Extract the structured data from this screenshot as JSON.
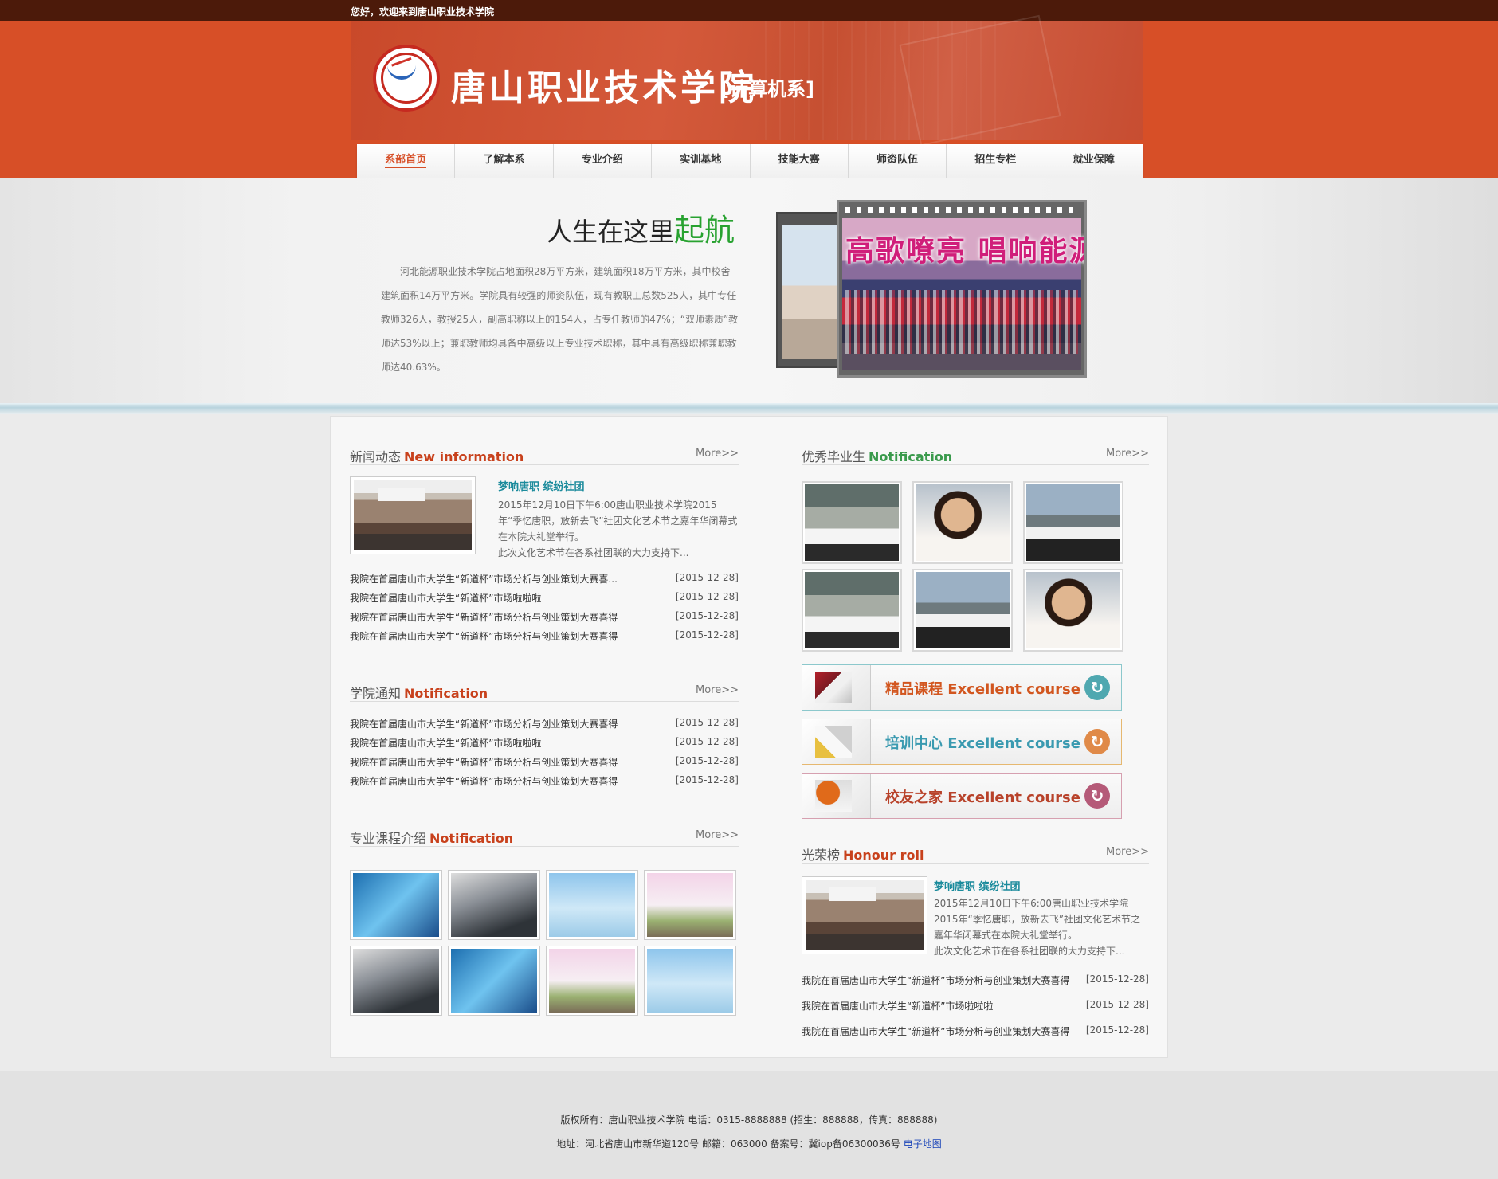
{
  "topbar": {
    "welcome": "您好，欢迎来到唐山职业技术学院"
  },
  "header": {
    "school_name": "唐山职业技术学院",
    "department": "[计算机系]"
  },
  "nav": {
    "items": [
      "系部首页",
      "了解本系",
      "专业介绍",
      "实训基地",
      "技能大赛",
      "师资队伍",
      "招生专栏",
      "就业保障"
    ],
    "active": "系部首页"
  },
  "hero": {
    "title_prefix": "人生在这里",
    "title_accent": "起航",
    "text": "河北能源职业技术学院占地面积28万平方米，建筑面积18万平方米，其中校舍建筑面积14万平方米。学院具有较强的师资队伍，现有教职工总数525人，其中专任教师326人，教授25人，副高职称以上的154人，占专任教师的47%；“双师素质”教师达53%以上；兼职教师均具备中高级以上专业技术职称，其中具有高级职称兼职教师达40.63%。",
    "photo_caption": "高歌嘹亮  唱响能源"
  },
  "news": {
    "title_cn": "新闻动态",
    "title_en": "New information",
    "more": "More>>",
    "feature_title": "梦响唐职 缤纷社团",
    "feature_text": "2015年12月10日下午6:00唐山职业技术学院2015年“季忆唐职，放新去飞”社团文化艺术节之嘉年华闭幕式在本院大礼堂举行。",
    "feature_text2": "此次文化艺术节在各系社团联的大力支持下...",
    "items": [
      {
        "title": "我院在首届唐山市大学生“新道杯”市场分析与创业策划大赛喜...",
        "date": "[2015-12-28]"
      },
      {
        "title": "我院在首届唐山市大学生“新道杯”市场啦啦啦",
        "date": "[2015-12-28]"
      },
      {
        "title": "我院在首届唐山市大学生“新道杯”市场分析与创业策划大赛喜得",
        "date": "[2015-12-28]"
      },
      {
        "title": "我院在首届唐山市大学生“新道杯”市场分析与创业策划大赛喜得",
        "date": "[2015-12-28]"
      }
    ]
  },
  "notice": {
    "title_cn": "学院通知",
    "title_en": "Notification",
    "more": "More>>",
    "items": [
      {
        "title": "我院在首届唐山市大学生“新道杯”市场分析与创业策划大赛喜得",
        "date": "[2015-12-28]"
      },
      {
        "title": "我院在首届唐山市大学生“新道杯”市场啦啦啦",
        "date": "[2015-12-28]"
      },
      {
        "title": "我院在首届唐山市大学生“新道杯”市场分析与创业策划大赛喜得",
        "date": "[2015-12-28]"
      },
      {
        "title": "我院在首届唐山市大学生“新道杯”市场分析与创业策划大赛喜得",
        "date": "[2015-12-28]"
      }
    ]
  },
  "courses": {
    "title_cn": "专业课程介绍",
    "title_en": "Notification",
    "more": "More>>"
  },
  "graduates": {
    "title_cn": "优秀毕业生",
    "title_en": "Notification",
    "more": "More>>"
  },
  "buttons": [
    {
      "cn": "精品课程",
      "en": "Excellent course"
    },
    {
      "cn": "培训中心",
      "en": "Excellent course"
    },
    {
      "cn": "校友之家",
      "en": "Excellent course"
    }
  ],
  "honour": {
    "title_cn": "光荣榜",
    "title_en": "Honour roll",
    "more": "More>>",
    "feature_title": "梦响唐职 缤纷社团",
    "feature_text": "2015年12月10日下午6:00唐山职业技术学院2015年“季忆唐职，放新去飞”社团文化艺术节之嘉年华闭幕式在本院大礼堂举行。",
    "feature_text2": "此次文化艺术节在各系社团联的大力支持下...",
    "items": [
      {
        "title": "我院在首届唐山市大学生“新道杯”市场分析与创业策划大赛喜得",
        "date": "[2015-12-28]"
      },
      {
        "title": "我院在首届唐山市大学生“新道杯”市场啦啦啦",
        "date": "[2015-12-28]"
      },
      {
        "title": "我院在首届唐山市大学生“新道杯”市场分析与创业策划大赛喜得",
        "date": "[2015-12-28]"
      }
    ]
  },
  "footer": {
    "line1": "版权所有：唐山职业技术学院 电话：0315-8888888 (招生：888888，传真：888888)",
    "line2": "地址：河北省唐山市新华道120号 邮籍：063000 备案号：冀iop备06300036号 ",
    "map_link": "电子地图"
  }
}
